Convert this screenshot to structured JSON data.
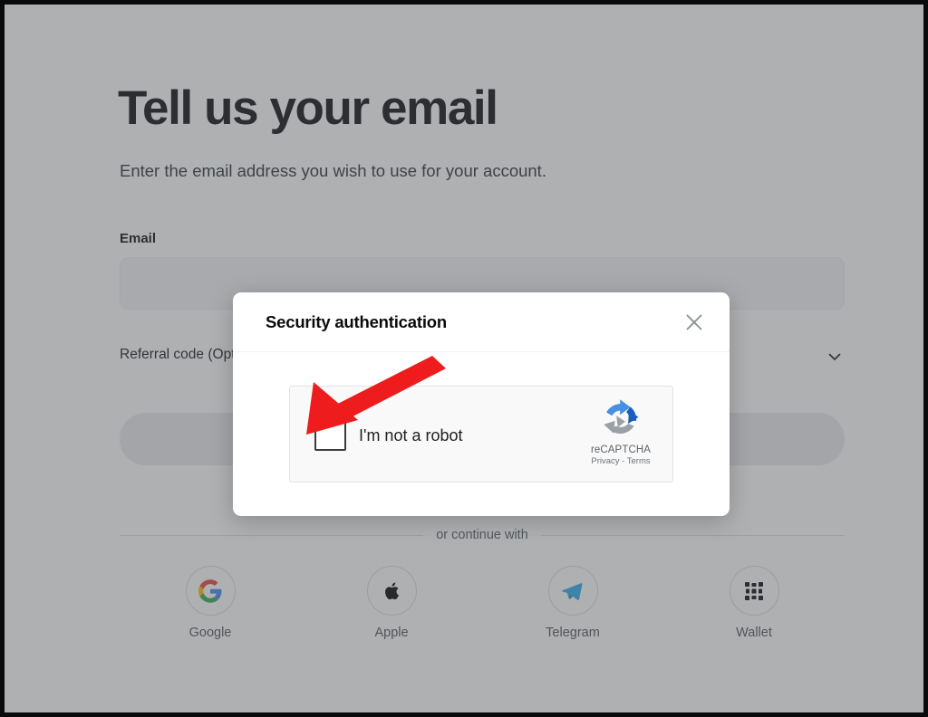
{
  "page": {
    "title": "Tell us your email",
    "subtitle": "Enter the email address you wish to use for your account.",
    "email_label": "Email",
    "email_value": "",
    "email_placeholder": "",
    "referral_label": "Referral code (Optional)",
    "submit_label": "",
    "divider_text": "or continue with",
    "chevron_icon": "chevron-down-icon"
  },
  "social": [
    {
      "label": "Google",
      "icon": "google-icon",
      "color": "#4285F4"
    },
    {
      "label": "Apple",
      "icon": "apple-icon",
      "color": "#000000"
    },
    {
      "label": "Telegram",
      "icon": "telegram-icon",
      "color": "#2AABEE"
    },
    {
      "label": "Wallet",
      "icon": "wallet-icon",
      "color": "#000000"
    }
  ],
  "modal": {
    "title": "Security authentication",
    "close_icon": "close-icon",
    "captcha": {
      "label": "I'm not a robot",
      "checked": false,
      "checkbox_icon": "checkbox-unchecked-icon",
      "brand_name": "reCAPTCHA",
      "brand_logo_icon": "recaptcha-logo-icon",
      "links": "Privacy - Terms",
      "privacy_label": "Privacy",
      "terms_label": "Terms"
    }
  },
  "annotation": {
    "arrow_icon": "red-arrow-icon",
    "arrow_color": "#EE1C1C",
    "points_to": "captcha-checkbox"
  },
  "colors": {
    "scrim": "#56585B",
    "page_bg": "#FFFFFF",
    "modal_bg": "#FFFFFF",
    "captcha_bg": "#F9F9F9",
    "text_primary": "#0B0B0C",
    "text_muted": "#52575D",
    "frame": "#0A0A0A"
  }
}
